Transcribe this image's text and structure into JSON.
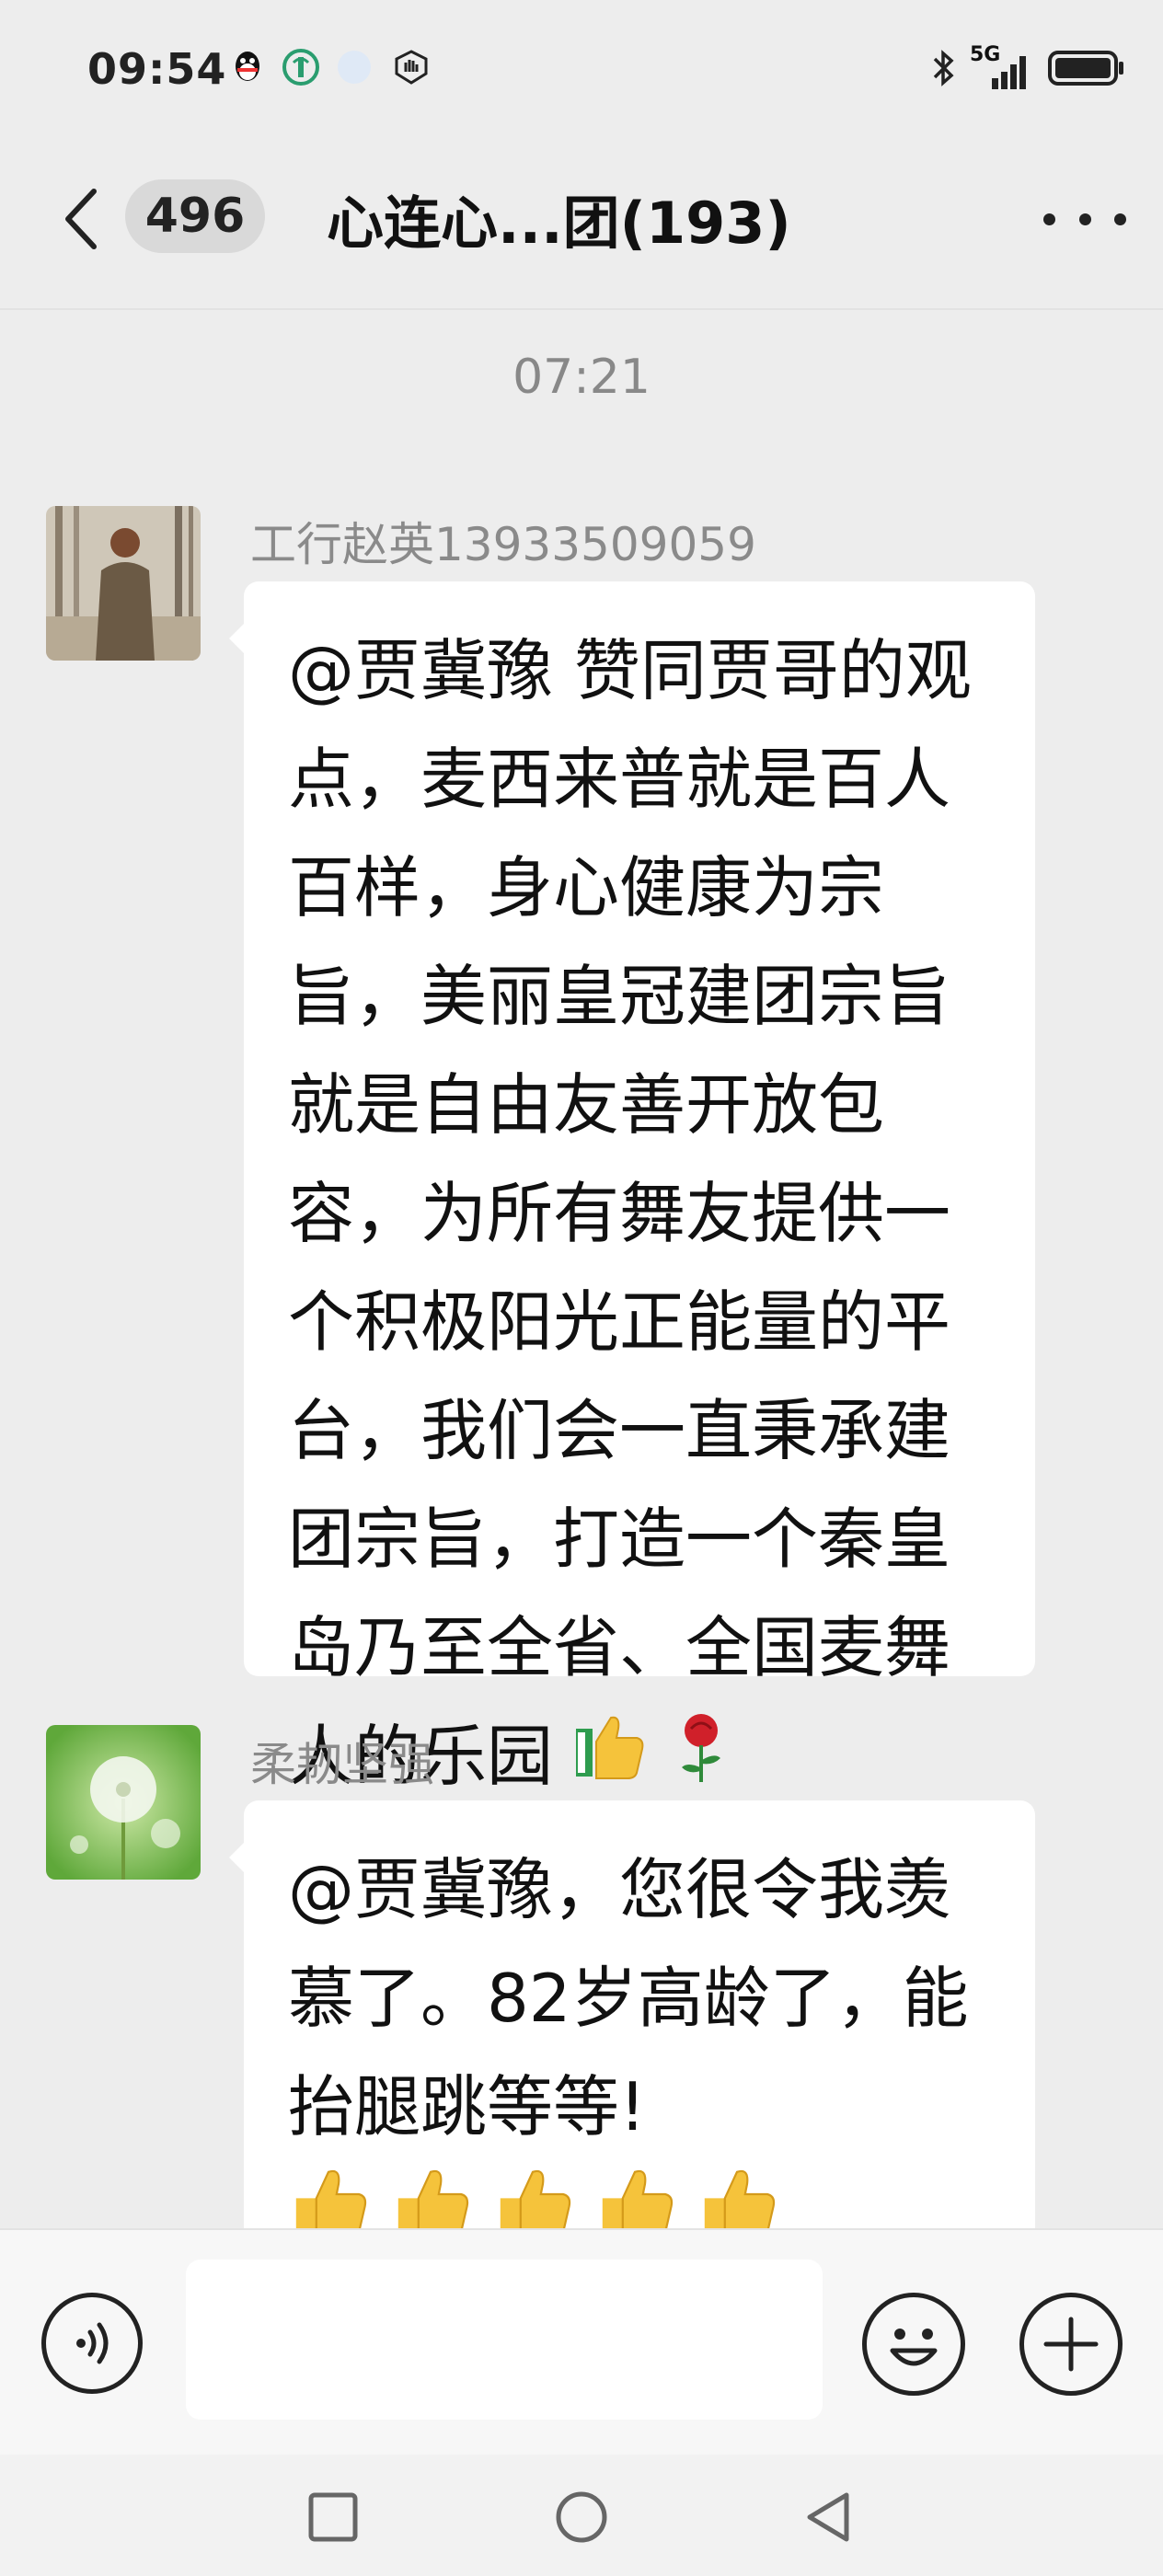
{
  "status_bar": {
    "time": "09:54",
    "network": "5G",
    "icons": [
      "qq-icon",
      "app-icon",
      "compass-icon",
      "shield-icon",
      "bluetooth-icon",
      "signal-icon",
      "battery-icon"
    ]
  },
  "header": {
    "back_icon": "chevron-left-icon",
    "unread_count": "496",
    "title": "心连心...团(193)",
    "more_icon": "more-icon"
  },
  "chat": {
    "timestamp": "07:21",
    "messages": [
      {
        "sender": "工行赵英13933509059",
        "text": "@贾冀豫  赞同贾哥的观点，麦西来普就是百人百样，身心健康为宗旨，美丽皇冠建团宗旨就是自由友善开放包容，为所有舞友提供一个积极阳光正能量的平台，我们会一直秉承建团宗旨，打造一个秦皇岛乃至全省、全国麦舞人的乐园",
        "emojis": [
          "thumbs-up-icon",
          "rose-icon"
        ]
      },
      {
        "sender": "柔韧坚强",
        "text": "@贾冀豫，您很令我羡慕了。82岁高龄了，能抬腿跳等等!",
        "emojis": [
          "thumbs-up-icon",
          "thumbs-up-icon",
          "thumbs-up-icon",
          "thumbs-up-icon",
          "thumbs-up-icon"
        ]
      }
    ]
  },
  "input_bar": {
    "voice_icon": "voice-icon",
    "emoji_icon": "emoji-icon",
    "plus_icon": "plus-icon",
    "input_value": ""
  },
  "nav_bar": {
    "items": [
      "recent-apps-icon",
      "home-icon",
      "back-icon"
    ]
  },
  "colors": {
    "background": "#ededed",
    "bubble": "#ffffff",
    "sender_text": "#8a8a8a"
  }
}
